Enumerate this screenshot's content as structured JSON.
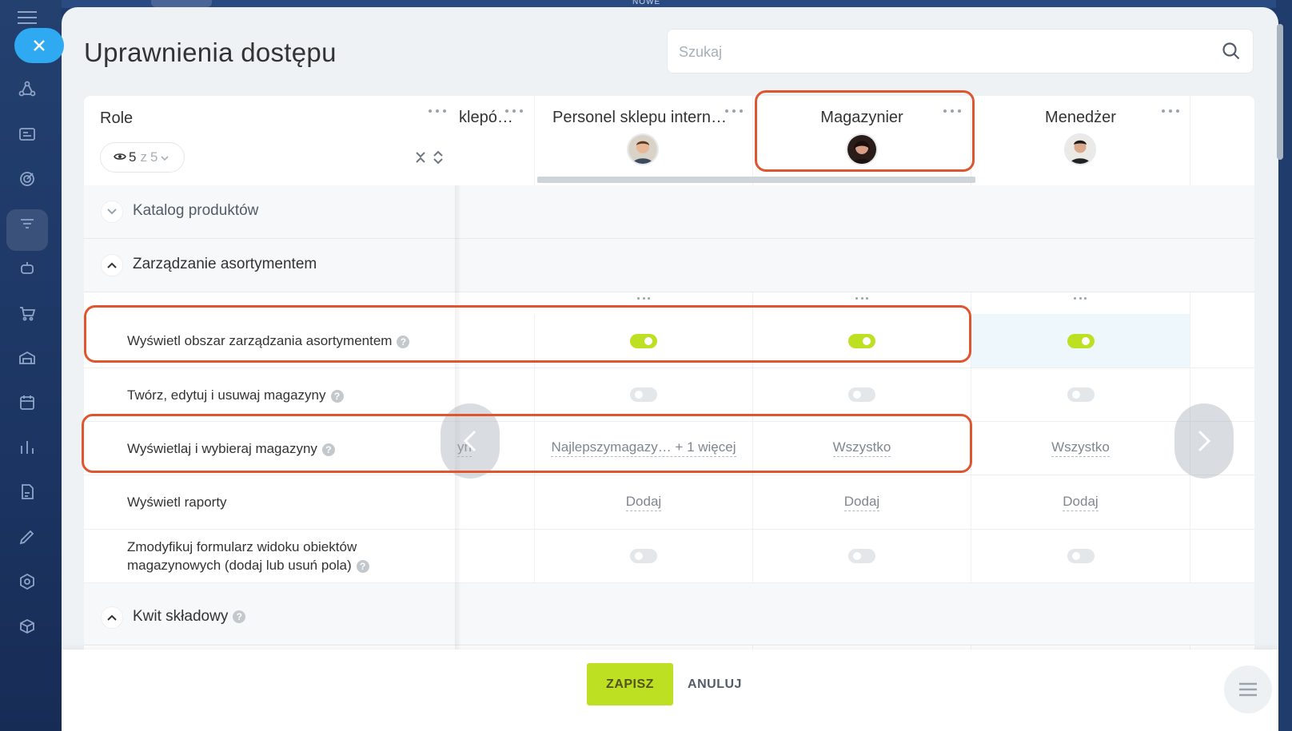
{
  "topbar": {
    "label": "NOWE"
  },
  "page": {
    "title": "Uprawnienia dostępu"
  },
  "search": {
    "placeholder": "Szukaj"
  },
  "roles": {
    "label": "Role",
    "shown": "5",
    "of_label": "z",
    "total": "5"
  },
  "columns": [
    {
      "title": "klepó…"
    },
    {
      "title": "Personel sklepu intern…",
      "avatar": "avatar-man-icon"
    },
    {
      "title": "Magazynier",
      "avatar": "avatar-woman-icon"
    },
    {
      "title": "Menedżer",
      "avatar": "avatar-man-dark-icon"
    }
  ],
  "sections": [
    {
      "label": "Katalog produktów",
      "expanded": false
    },
    {
      "label": "Zarządzanie asortymentem",
      "expanded": true
    },
    {
      "label": "Kwit składowy",
      "expanded": true
    }
  ],
  "permissions": [
    {
      "label": "Wyświetl obszar zarządzania asortymentem",
      "help": "?",
      "values": [
        "",
        "on",
        "on",
        "on"
      ]
    },
    {
      "label": "Twórz, edytuj i usuwaj magazyny",
      "help": "?",
      "values": [
        "",
        "off",
        "off",
        "off"
      ]
    },
    {
      "label": "Wyświetlaj i wybieraj magazyny",
      "help": "?",
      "values": [
        "yn",
        "Najlepszymagazy… + 1 więcej",
        "Wszystko",
        "Wszystko"
      ]
    },
    {
      "label": "Wyświetl raporty",
      "values": [
        "",
        "Dodaj",
        "Dodaj",
        "Dodaj"
      ]
    },
    {
      "label_line1": "Zmodyfikuj formularz widoku obiektów",
      "label_line2": "magazynowych (dodaj lub usuń pola)",
      "help": "?",
      "values": [
        "",
        "off",
        "off",
        "off"
      ]
    }
  ],
  "footer": {
    "save": "ZAPISZ",
    "cancel": "ANULUJ"
  },
  "colors": {
    "accent_green": "#bde022",
    "highlight_red": "#df5530",
    "close_blue": "#2fa9f2"
  }
}
